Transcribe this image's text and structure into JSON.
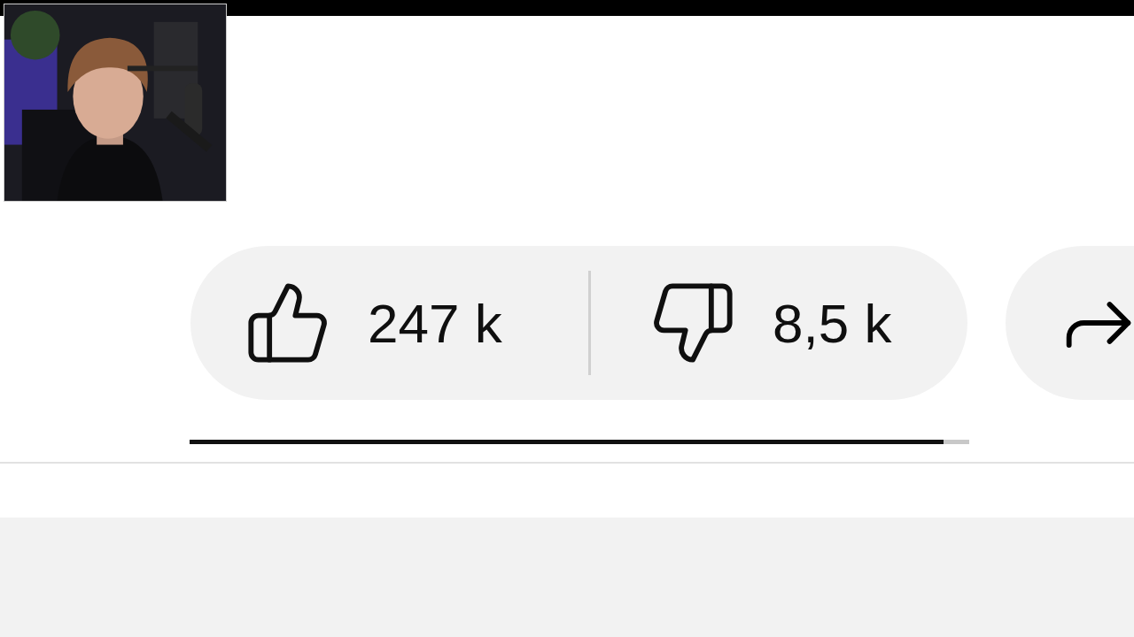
{
  "like_button": {
    "count": "247 k"
  },
  "dislike_button": {
    "count": "8,5 k"
  },
  "ratio_bar": {
    "level": 0.967
  }
}
